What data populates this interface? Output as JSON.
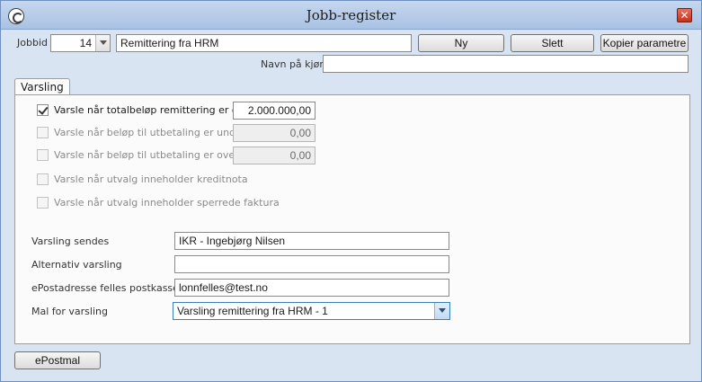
{
  "window": {
    "title": "Jobb-register",
    "close_glyph": "✕"
  },
  "top": {
    "jobbid_label": "Jobbid",
    "jobbid_value": "14",
    "job_name": "Remittering fra HRM",
    "ny_label": "Ny",
    "slett_label": "Slett",
    "kopier_label": "Kopier parametre",
    "navn_label": "Navn på kjøring",
    "navn_value": ""
  },
  "tab": {
    "label": "Varsling"
  },
  "varsling": {
    "checks": [
      {
        "label": "Varsle når totalbeløp remittering er over:",
        "value": "2.000.000,00",
        "checked": true,
        "enabled": true
      },
      {
        "label": "Varsle når beløp til utbetaling er under:",
        "value": "0,00",
        "checked": false,
        "enabled": false
      },
      {
        "label": "Varsle når beløp til utbetaling er over:",
        "value": "0,00",
        "checked": false,
        "enabled": false
      },
      {
        "label": "Varsle når utvalg inneholder kreditnota",
        "checked": false,
        "enabled": false
      },
      {
        "label": "Varsle når utvalg inneholder sperrede faktura",
        "checked": false,
        "enabled": false
      }
    ],
    "sendes_label": "Varsling sendes",
    "sendes_value": "IKR - Ingebjørg Nilsen",
    "alternativ_label": "Alternativ varsling",
    "alternativ_value": "",
    "epost_label": "ePostadresse felles postkasse",
    "epost_value": "lonnfelles@test.no",
    "mal_label": "Mal for varsling",
    "mal_value": "Varsling remittering fra HRM - 1"
  },
  "bottom": {
    "epostmal_label": "ePostmal"
  }
}
